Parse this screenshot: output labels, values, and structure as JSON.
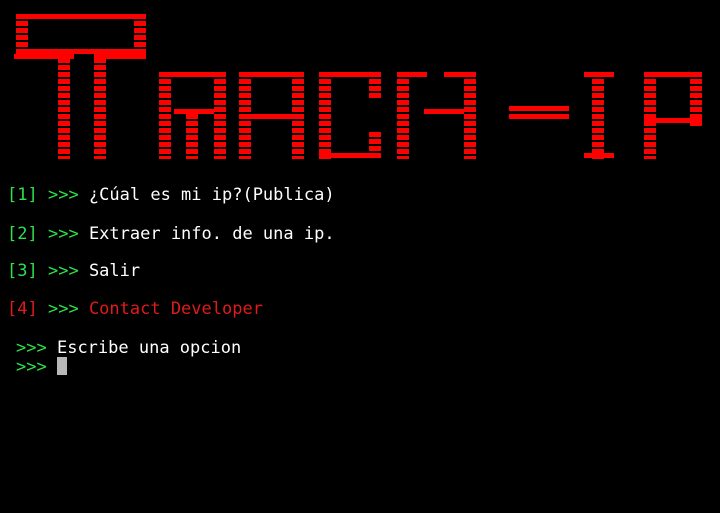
{
  "banner": {
    "text": "Track-ip",
    "color": "#ff0000"
  },
  "colors": {
    "background": "#000000",
    "prompt": "#2ee04a",
    "option_text": "#ffffff",
    "developer": "#e01b1b"
  },
  "menu": [
    {
      "number": "[1]",
      "arrow": ">>>",
      "label": "¿Cúal es mi ip?(Publica)"
    },
    {
      "number": "[2]",
      "arrow": ">>>",
      "label": "Extraer info. de una ip."
    },
    {
      "number": "[3]",
      "arrow": ">>>",
      "label": "Salir"
    },
    {
      "number": "[4]",
      "arrow": ">>>",
      "label": "Contact Developer"
    }
  ],
  "prompt": {
    "arrow": ">>>",
    "message": "Escribe una opcion",
    "input_arrow": ">>>",
    "input_value": ""
  }
}
